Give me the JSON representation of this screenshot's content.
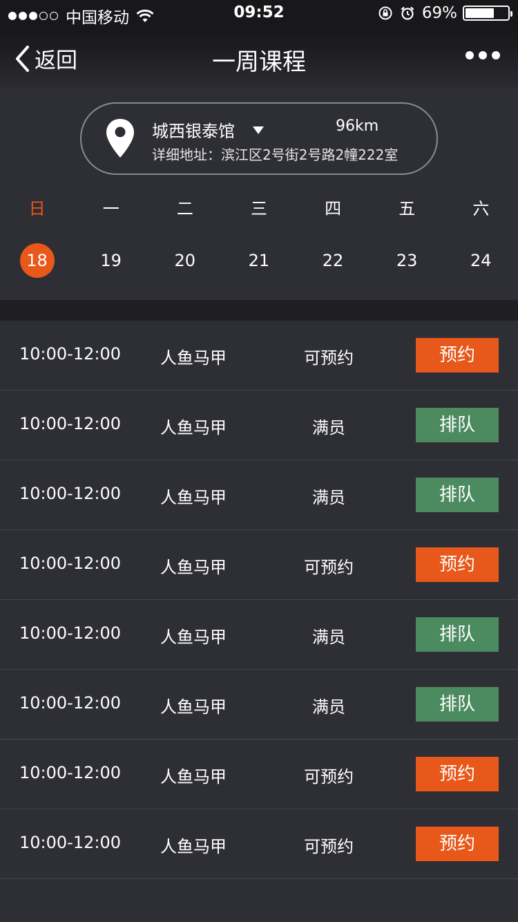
{
  "status_bar": {
    "carrier": "中国移动",
    "time": "09:52",
    "battery_pct": "69%",
    "battery_level": 0.69,
    "signal_bars_full": 3,
    "signal_bars_total": 5
  },
  "nav": {
    "back_label": "返回",
    "title": "一周课程"
  },
  "location": {
    "venue": "城西银泰馆",
    "distance": "96km",
    "address": "详细地址：滨江区2号街2号路2幢222室"
  },
  "week": {
    "days": [
      "日",
      "一",
      "二",
      "三",
      "四",
      "五",
      "六"
    ],
    "dates": [
      "18",
      "19",
      "20",
      "21",
      "22",
      "23",
      "24"
    ],
    "selected_index": 0
  },
  "colors": {
    "accent": "#e8581a",
    "queue_green": "#4c8a5f",
    "background": "#2e2e35"
  },
  "courses": [
    {
      "time": "10:00-12:00",
      "name": "人鱼马甲",
      "status": "可预约",
      "action": "预约",
      "type": "book"
    },
    {
      "time": "10:00-12:00",
      "name": "人鱼马甲",
      "status": "满员",
      "action": "排队",
      "type": "queue"
    },
    {
      "time": "10:00-12:00",
      "name": "人鱼马甲",
      "status": "满员",
      "action": "排队",
      "type": "queue"
    },
    {
      "time": "10:00-12:00",
      "name": "人鱼马甲",
      "status": "可预约",
      "action": "预约",
      "type": "book"
    },
    {
      "time": "10:00-12:00",
      "name": "人鱼马甲",
      "status": "满员",
      "action": "排队",
      "type": "queue"
    },
    {
      "time": "10:00-12:00",
      "name": "人鱼马甲",
      "status": "满员",
      "action": "排队",
      "type": "queue"
    },
    {
      "time": "10:00-12:00",
      "name": "人鱼马甲",
      "status": "可预约",
      "action": "预约",
      "type": "book"
    },
    {
      "time": "10:00-12:00",
      "name": "人鱼马甲",
      "status": "可预约",
      "action": "预约",
      "type": "book"
    }
  ]
}
